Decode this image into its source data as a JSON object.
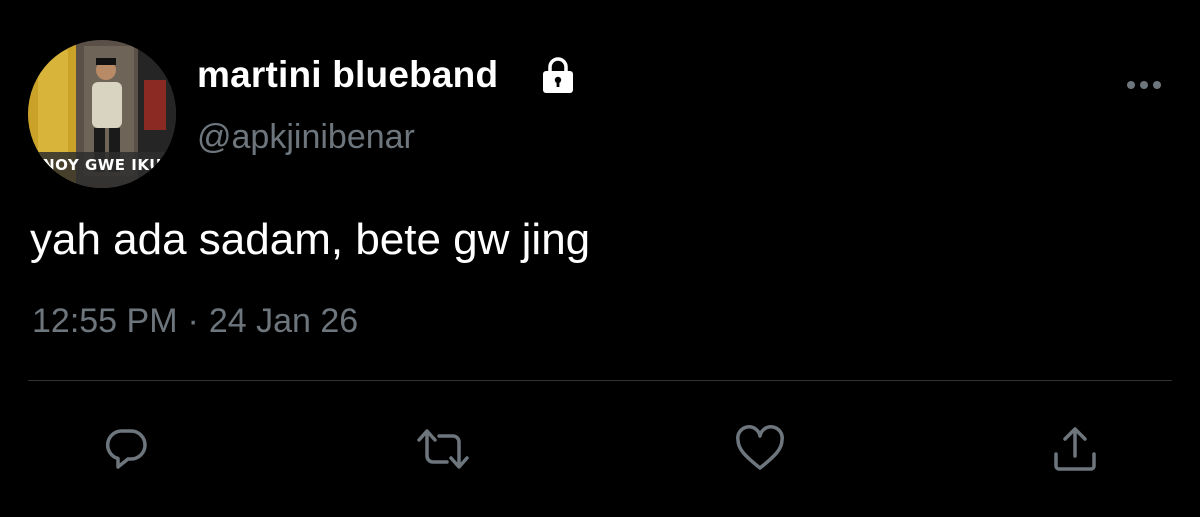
{
  "author": {
    "display_name": "martini blueband",
    "handle": "@apkjinibenar",
    "protected": true,
    "avatar_caption": "NOY GWE IKU"
  },
  "tweet": {
    "text": "yah ada sadam, bete gw jing",
    "time": "12:55 PM",
    "separator": "·",
    "date": "24 Jan 26"
  },
  "icons": {
    "lock": "lock-icon",
    "more": "more-options-icon",
    "reply": "reply-icon",
    "retweet": "retweet-icon",
    "like": "heart-icon",
    "share": "share-icon"
  },
  "colors": {
    "background": "#000000",
    "primary_text": "#ffffff",
    "secondary_text": "#6e767d",
    "divider": "#2f3336",
    "icon": "#6e767d"
  }
}
